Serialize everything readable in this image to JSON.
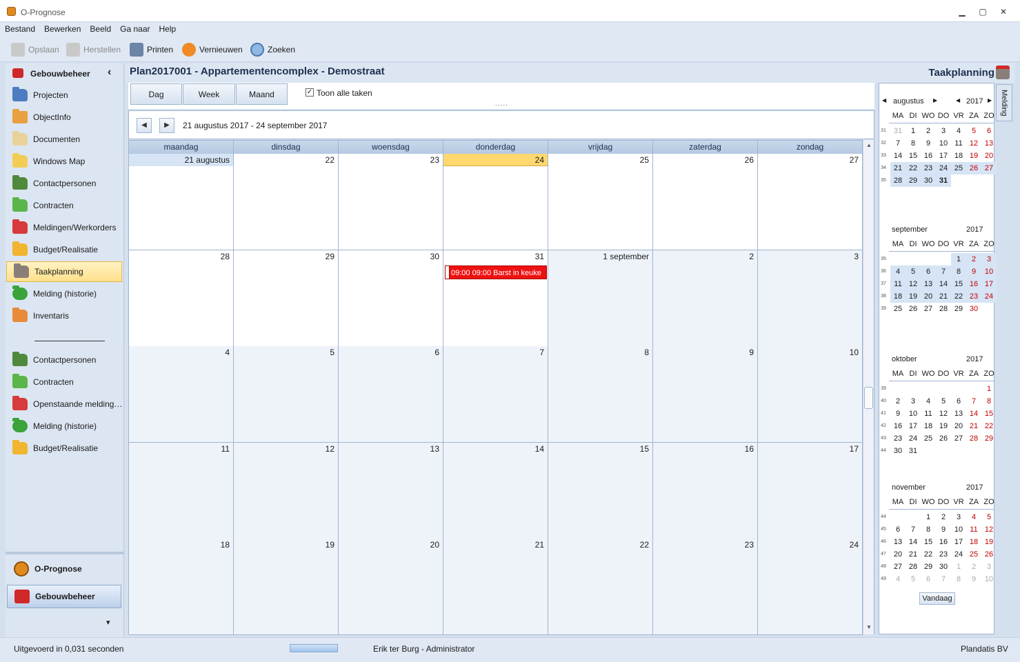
{
  "window": {
    "title": "O-Prognose",
    "minimize_glyph": "▁",
    "restore_glyph": "▢",
    "close_glyph": "✕"
  },
  "menu": [
    "Bestand",
    "Bewerken",
    "Beeld",
    "Ga naar",
    "Help"
  ],
  "toolbar": {
    "save": "Opslaan",
    "undo": "Herstellen",
    "print": "Printen",
    "refresh": "Vernieuwen",
    "search": "Zoeken"
  },
  "nav": {
    "header": "Gebouwbeheer",
    "collapse_glyph": "‹",
    "items": [
      "Projecten",
      "ObjectInfo",
      "Documenten",
      "Windows Map",
      "Contactpersonen",
      "Contracten",
      "Meldingen/Werkorders",
      "Budget/Realisatie",
      "Taakplanning",
      "Melding (historie)",
      "Inventaris"
    ],
    "items2": [
      "Contactpersonen",
      "Contracten",
      "Openstaande melding…",
      "Melding (historie)",
      "Budget/Realisatie"
    ],
    "modules": [
      "O-Prognose",
      "Gebouwbeheer"
    ],
    "more_glyph": "▾"
  },
  "header": {
    "title": "Plan2017001 - Appartementencomplex - Demostraat",
    "module": "Taakplanning"
  },
  "view": {
    "day": "Dag",
    "week": "Week",
    "month": "Maand",
    "show_all": "Toon alle taken",
    "handle": "....."
  },
  "range": {
    "label": "21 augustus 2017 - 24 september 2017",
    "prev": "◀",
    "next": "▶"
  },
  "calendar": {
    "weekdays": [
      "maandag",
      "dinsdag",
      "woensdag",
      "donderdag",
      "vrijdag",
      "zaterdag",
      "zondag"
    ],
    "weeks": [
      [
        "21 augustus",
        "22",
        "23",
        "24",
        "25",
        "26",
        "27"
      ],
      [
        "28",
        "29",
        "30",
        "31",
        "1 september",
        "2",
        "3"
      ],
      [
        "4",
        "5",
        "6",
        "7",
        "8",
        "9",
        "10"
      ],
      [
        "11",
        "12",
        "13",
        "14",
        "15",
        "16",
        "17"
      ],
      [
        "18",
        "19",
        "20",
        "21",
        "22",
        "23",
        "24"
      ]
    ],
    "appointment": "09:00  09:00  Barst in keuke"
  },
  "mini": {
    "dayheads": [
      "MA",
      "DI",
      "WO",
      "DO",
      "VR",
      "ZA",
      "ZO"
    ],
    "today_button": "Vandaag",
    "months": [
      {
        "name": "augustus",
        "year": "2017",
        "nav": true,
        "weeks": [
          [
            "31",
            "31",
            "1",
            "2",
            "3",
            "4",
            "5",
            "6"
          ],
          [
            "32",
            "7",
            "8",
            "9",
            "10",
            "11",
            "12",
            "13"
          ],
          [
            "33",
            "14",
            "15",
            "16",
            "17",
            "18",
            "19",
            "20"
          ],
          [
            "34",
            "21",
            "22",
            "23",
            "24",
            "25",
            "26",
            "27"
          ],
          [
            "35",
            "28",
            "29",
            "30",
            "31",
            "",
            "",
            ""
          ]
        ]
      },
      {
        "name": "september",
        "year": "2017",
        "weeks": [
          [
            "35",
            "",
            "",
            "",
            "",
            "1",
            "2",
            "3"
          ],
          [
            "36",
            "4",
            "5",
            "6",
            "7",
            "8",
            "9",
            "10"
          ],
          [
            "37",
            "11",
            "12",
            "13",
            "14",
            "15",
            "16",
            "17"
          ],
          [
            "38",
            "18",
            "19",
            "20",
            "21",
            "22",
            "23",
            "24"
          ],
          [
            "39",
            "25",
            "26",
            "27",
            "28",
            "29",
            "30",
            ""
          ]
        ]
      },
      {
        "name": "oktober",
        "year": "2017",
        "weeks": [
          [
            "39",
            "",
            "",
            "",
            "",
            "",
            "",
            "1"
          ],
          [
            "40",
            "2",
            "3",
            "4",
            "5",
            "6",
            "7",
            "8"
          ],
          [
            "41",
            "9",
            "10",
            "11",
            "12",
            "13",
            "14",
            "15"
          ],
          [
            "42",
            "16",
            "17",
            "18",
            "19",
            "20",
            "21",
            "22"
          ],
          [
            "43",
            "23",
            "24",
            "25",
            "26",
            "27",
            "28",
            "29"
          ],
          [
            "44",
            "30",
            "31",
            "",
            "",
            "",
            "",
            ""
          ]
        ]
      },
      {
        "name": "november",
        "year": "2017",
        "weeks": [
          [
            "44",
            "",
            "",
            "1",
            "2",
            "3",
            "4",
            "5"
          ],
          [
            "45",
            "6",
            "7",
            "8",
            "9",
            "10",
            "11",
            "12"
          ],
          [
            "46",
            "13",
            "14",
            "15",
            "16",
            "17",
            "18",
            "19"
          ],
          [
            "47",
            "20",
            "21",
            "22",
            "23",
            "24",
            "25",
            "26"
          ],
          [
            "48",
            "27",
            "28",
            "29",
            "30",
            "1",
            "2",
            "3"
          ],
          [
            "49",
            "4",
            "5",
            "6",
            "7",
            "8",
            "9",
            "10"
          ]
        ]
      }
    ]
  },
  "side_tab": "Melding",
  "status": {
    "left": "Uitgevoerd in 0,031 seconden",
    "user": "Erik ter Burg - Administrator",
    "company": "Plandatis BV"
  },
  "colors": {
    "accent": "#ffd870",
    "appointment": "#ee1111",
    "weekend": "#c00000"
  }
}
